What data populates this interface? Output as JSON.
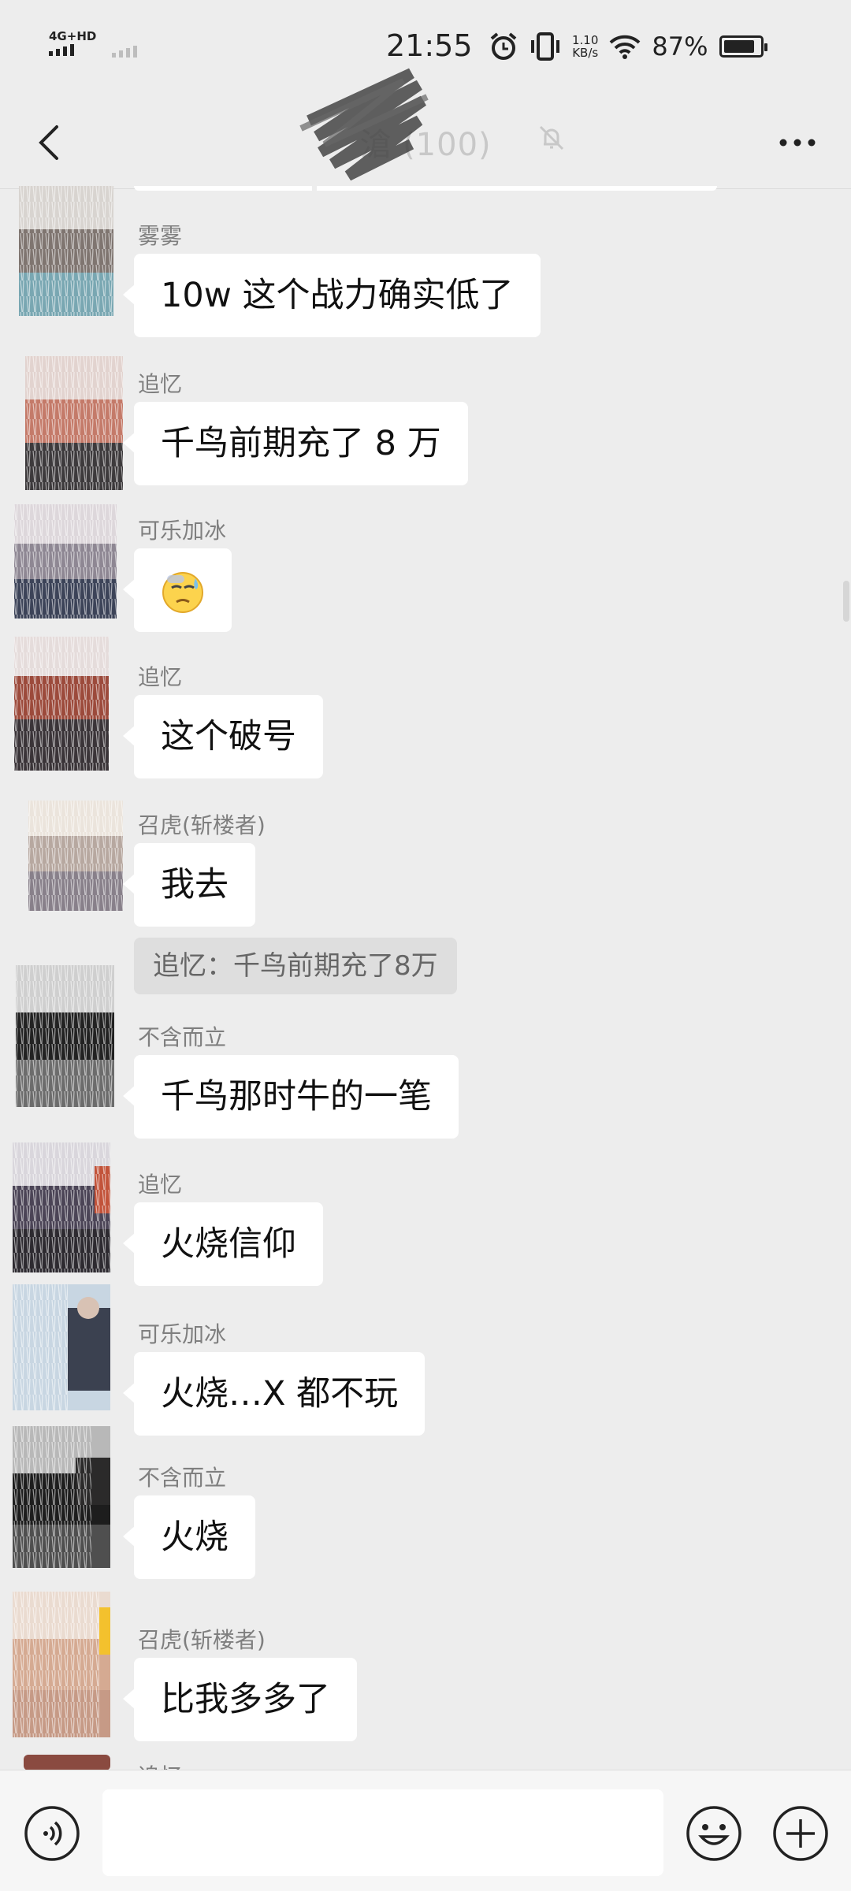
{
  "status_bar": {
    "network": "4G+HD",
    "time": "21:55",
    "speed_value": "1.10",
    "speed_unit": "KB/s",
    "battery": "87%",
    "battery_level": 0.87
  },
  "nav": {
    "title": "滄      (100)"
  },
  "messages": [
    {
      "sender": "雾雾",
      "text": "10w 这个战力确实低了"
    },
    {
      "sender": "追忆",
      "text": "千鸟前期充了 8 万"
    },
    {
      "sender": "可乐加冰",
      "text": "",
      "emoji": "cold-sweat-emoji"
    },
    {
      "sender": "追忆",
      "text": "这个破号"
    },
    {
      "sender": "召虎(斩楼者)",
      "text": "我去",
      "quote": "追忆：千鸟前期充了8万"
    },
    {
      "sender": "不含而立",
      "text": "千鸟那时牛的一笔"
    },
    {
      "sender": "追忆",
      "text": "火烧信仰"
    },
    {
      "sender": "可乐加冰",
      "text": "火烧…X 都不玩"
    },
    {
      "sender": "不含而立",
      "text": "火烧"
    },
    {
      "sender": "召虎(斩楼者)",
      "text": "比我多多了"
    },
    {
      "sender": "追忆",
      "text": ""
    }
  ],
  "input": {
    "placeholder": ""
  },
  "icons": {
    "back": "back-chevron-icon",
    "mute": "mute-bell-icon",
    "more": "more-icon",
    "voice": "voice-icon",
    "emoji": "emoji-icon",
    "plus": "plus-icon"
  },
  "colors": {
    "background": "#ededed",
    "bubble": "#ffffff",
    "sender": "#7f7f7f",
    "quote_bg": "#dedede"
  }
}
